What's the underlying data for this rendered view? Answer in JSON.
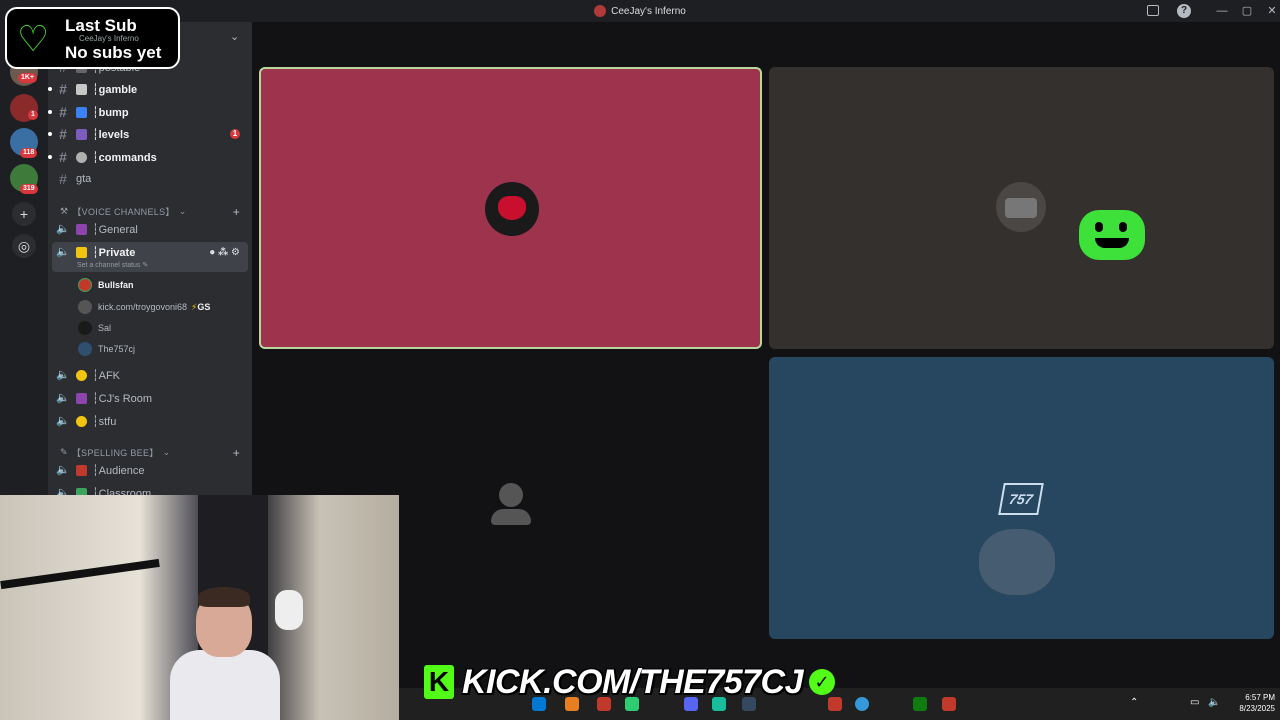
{
  "window": {
    "title": "CeeJay's Inferno"
  },
  "servers": [
    {
      "badge": "1K+",
      "color": "#6d5a4e"
    },
    {
      "badge": "1",
      "color": "#8b2a2a"
    },
    {
      "badge": "118",
      "color": "#3a6fa3"
    },
    {
      "badge": "319",
      "color": "#3e7a3a"
    }
  ],
  "overlay": {
    "title": "Last Sub",
    "value": "No subs yet"
  },
  "sidebar": {
    "server_name": "CeeJay's Inferno",
    "text_channels": [
      {
        "name": "┆postable"
      },
      {
        "name": "┆gamble"
      },
      {
        "name": "┆bump"
      },
      {
        "name": "┆levels",
        "mentions": "1"
      },
      {
        "name": "┆commands"
      },
      {
        "name": "gta"
      }
    ],
    "voice_category": "【VOICE CHANNELS】",
    "voice_channels": [
      {
        "name": "┆General"
      },
      {
        "name": "┆Private",
        "status": "Set a channel status"
      },
      {
        "name": "┆AFK"
      },
      {
        "name": "┆CJ's Room"
      },
      {
        "name": "┆stfu"
      }
    ],
    "private_members": [
      {
        "name": "Bullsfan"
      },
      {
        "name": "kick.com/troygovoni68",
        "tag": "GS"
      },
      {
        "name": "Sal"
      },
      {
        "name": "The757cj"
      }
    ],
    "spelling_category": "【SPELLING BEE】",
    "spelling_channels": [
      {
        "name": "┆Audience"
      },
      {
        "name": "┆Classroom"
      }
    ]
  },
  "banner": {
    "k": "K",
    "text": "KICK.COM/THE757CJ",
    "check": "✓"
  },
  "tiles": {
    "logo_757": "757"
  },
  "taskbar": {
    "time": "6:57 PM",
    "date": "8/23/2025"
  }
}
